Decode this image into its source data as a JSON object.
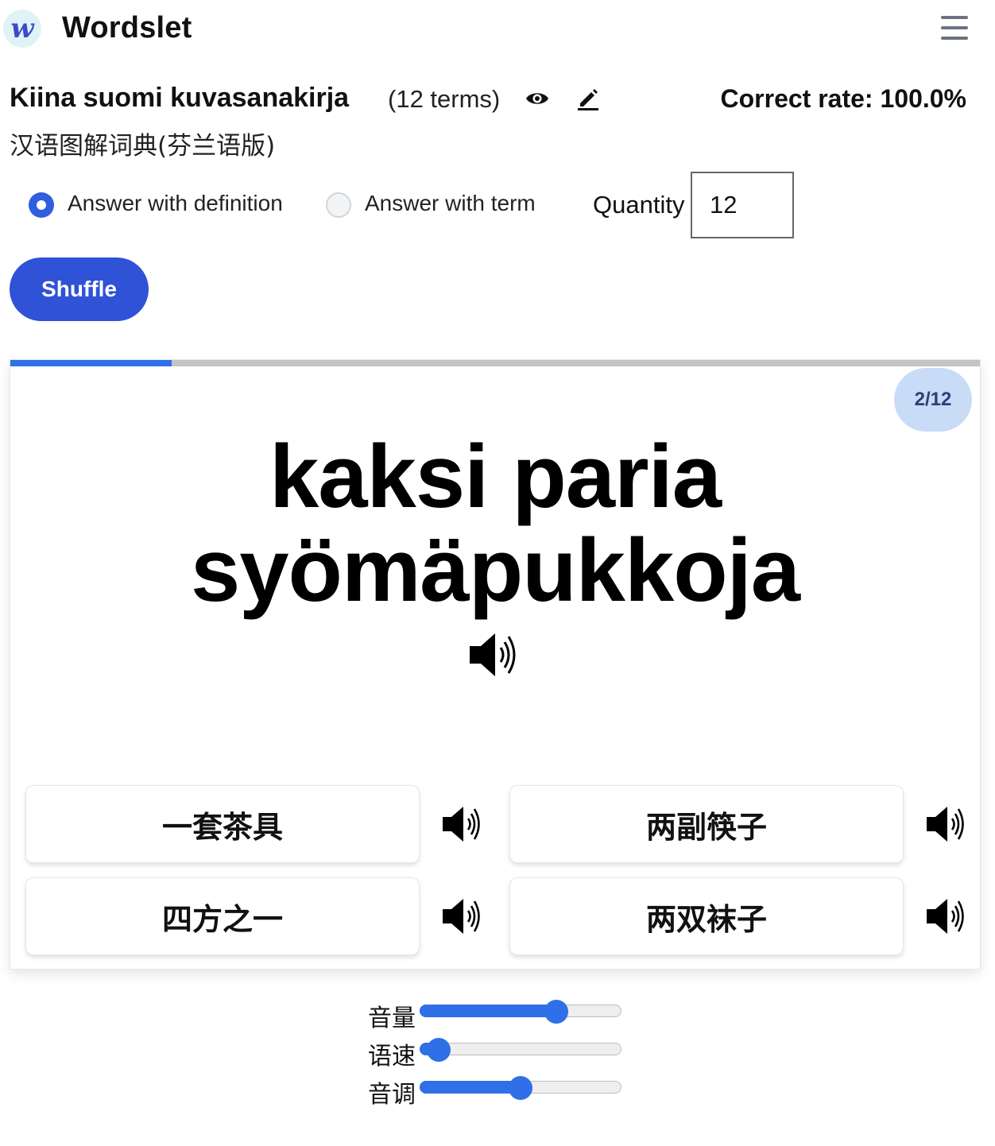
{
  "app": {
    "logo_letter": "w",
    "brand": "Wordslet"
  },
  "deck": {
    "title": "Kiina suomi kuvasanakirja",
    "term_count": "(12 terms)",
    "subtitle": "汉语图解词典(芬兰语版)",
    "correct_rate": "Correct rate: 100.0%"
  },
  "options": {
    "answer_with_definition": "Answer with definition",
    "answer_with_term": "Answer with term",
    "selected": "definition",
    "quantity_label": "Quantity",
    "quantity_value": "12"
  },
  "shuffle_label": "Shuffle",
  "quiz": {
    "progress_fraction": 0.1667,
    "counter": "2/12",
    "prompt_line1": "kaksi paria",
    "prompt_line2": "syömäpukkoja",
    "choices": [
      {
        "label": "一套茶具"
      },
      {
        "label": "两副筷子"
      },
      {
        "label": "四方之一"
      },
      {
        "label": "两双袜子"
      }
    ]
  },
  "audio_settings": {
    "volume_label": "音量",
    "volume_value": 0.68,
    "rate_label": "语速",
    "rate_value": 0.09,
    "pitch_label": "音调",
    "pitch_value": 0.5
  },
  "colors": {
    "accent": "#2f52d6",
    "progress": "#2f6fe8",
    "badge_bg": "#c9dcf7"
  },
  "icons": {
    "menu": "hamburger-menu-icon",
    "view": "eye-icon",
    "edit": "pencil-icon",
    "audio": "speaker-icon"
  }
}
